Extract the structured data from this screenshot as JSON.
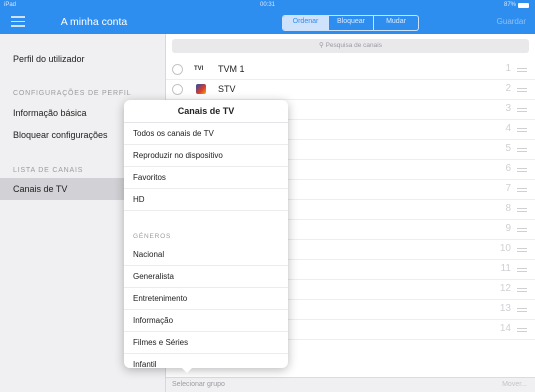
{
  "status": {
    "carrier": "iPad",
    "time": "00:31",
    "battery": "87%"
  },
  "nav": {
    "title": "A minha conta",
    "segments": [
      "Ordenar",
      "Bloquear",
      "Mudar"
    ],
    "save_label": "Guardar"
  },
  "sidebar": {
    "profile": "Perfil do utilizador",
    "config_header": "CONFIGURAÇÕES DE PERFIL",
    "basic_info": "Informação básica",
    "block_settings": "Bloquear configurações",
    "channels_header": "LISTA DE CANAIS",
    "tv_channels": "Canais de TV"
  },
  "search": {
    "placeholder": "Pesquisa de canais"
  },
  "channels": [
    {
      "logo": "TVI",
      "name": "TVM 1",
      "number": "1"
    },
    {
      "logo": "stv",
      "name": "STV",
      "number": "2"
    },
    {
      "number": "3"
    },
    {
      "number": "4"
    },
    {
      "number": "5"
    },
    {
      "number": "6"
    },
    {
      "number": "7"
    },
    {
      "number": "8"
    },
    {
      "number": "9"
    },
    {
      "number": "10"
    },
    {
      "number": "11"
    },
    {
      "number": "12"
    },
    {
      "number": "13"
    },
    {
      "number": "14"
    }
  ],
  "bottom": {
    "select_group": "Selecionar grupo",
    "move": "Mover..."
  },
  "popover": {
    "title": "Canais de TV",
    "items": [
      "Todos os canais de TV",
      "Reproduzir no dispositivo",
      "Favoritos",
      "HD"
    ],
    "genres_header": "GÉNEROS",
    "genres": [
      "Nacional",
      "Generalista",
      "Entretenimento",
      "Informação",
      "Filmes e Séries",
      "Infantil"
    ]
  },
  "colors": {
    "accent": "#2e8ef0"
  }
}
